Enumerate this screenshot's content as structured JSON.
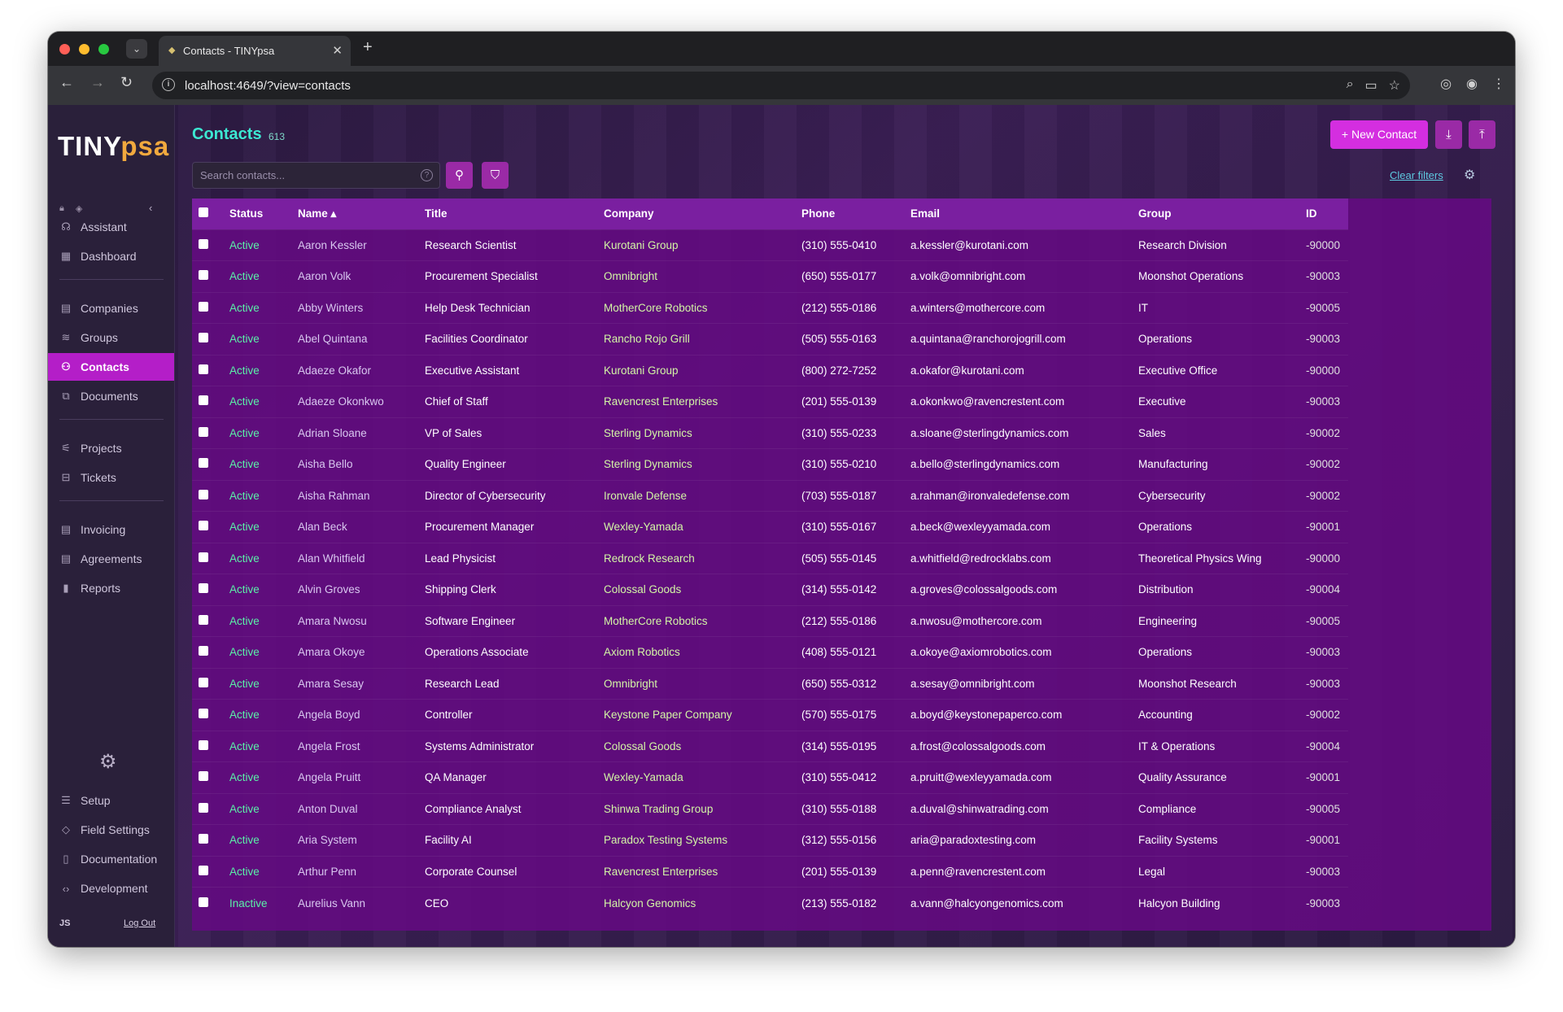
{
  "browser": {
    "tab_title": "Contacts - TINYpsa",
    "url": "localhost:4649/?view=contacts"
  },
  "app": {
    "logo_main": "TINY",
    "logo_accent": "psa",
    "sidebar": {
      "group1": [
        {
          "label": "Assistant",
          "icon": "headset-icon"
        },
        {
          "label": "Dashboard",
          "icon": "dashboard-icon"
        }
      ],
      "group2": [
        {
          "label": "Companies",
          "icon": "building-icon"
        },
        {
          "label": "Groups",
          "icon": "layers-icon"
        },
        {
          "label": "Contacts",
          "icon": "users-icon"
        },
        {
          "label": "Documents",
          "icon": "document-icon"
        }
      ],
      "group3": [
        {
          "label": "Projects",
          "icon": "projects-icon"
        },
        {
          "label": "Tickets",
          "icon": "ticket-icon"
        }
      ],
      "group4": [
        {
          "label": "Invoicing",
          "icon": "invoice-icon"
        },
        {
          "label": "Agreements",
          "icon": "agreement-icon"
        },
        {
          "label": "Reports",
          "icon": "chart-icon"
        }
      ],
      "bottom": [
        {
          "label": "Setup",
          "icon": "sliders-icon"
        },
        {
          "label": "Field Settings",
          "icon": "tag-icon"
        },
        {
          "label": "Documentation",
          "icon": "book-icon"
        },
        {
          "label": "Development",
          "icon": "code-icon"
        }
      ],
      "user_initials": "JS",
      "logout_label": "Log Out"
    },
    "page": {
      "title": "Contacts",
      "count": "613",
      "new_button": "+ New Contact",
      "search_placeholder": "Search contacts...",
      "clear_filters": "Clear filters"
    },
    "table": {
      "columns": [
        "Status",
        "Name ▴",
        "Title",
        "Company",
        "Phone",
        "Email",
        "Group",
        "ID"
      ],
      "rows": [
        [
          "Active",
          "Aaron Kessler",
          "Research Scientist",
          "Kurotani Group",
          "(310) 555-0410",
          "a.kessler@kurotani.com",
          "Research Division",
          "-90000"
        ],
        [
          "Active",
          "Aaron Volk",
          "Procurement Specialist",
          "Omnibright",
          "(650) 555-0177",
          "a.volk@omnibright.com",
          "Moonshot Operations",
          "-90003"
        ],
        [
          "Active",
          "Abby Winters",
          "Help Desk Technician",
          "MotherCore Robotics",
          "(212) 555-0186",
          "a.winters@mothercore.com",
          "IT",
          "-90005"
        ],
        [
          "Active",
          "Abel Quintana",
          "Facilities Coordinator",
          "Rancho Rojo Grill",
          "(505) 555-0163",
          "a.quintana@ranchorojogrill.com",
          "Operations",
          "-90003"
        ],
        [
          "Active",
          "Adaeze Okafor",
          "Executive Assistant",
          "Kurotani Group",
          "(800) 272-7252",
          "a.okafor@kurotani.com",
          "Executive Office",
          "-90000"
        ],
        [
          "Active",
          "Adaeze Okonkwo",
          "Chief of Staff",
          "Ravencrest Enterprises",
          "(201) 555-0139",
          "a.okonkwo@ravencrestent.com",
          "Executive",
          "-90003"
        ],
        [
          "Active",
          "Adrian Sloane",
          "VP of Sales",
          "Sterling Dynamics",
          "(310) 555-0233",
          "a.sloane@sterlingdynamics.com",
          "Sales",
          "-90002"
        ],
        [
          "Active",
          "Aisha Bello",
          "Quality Engineer",
          "Sterling Dynamics",
          "(310) 555-0210",
          "a.bello@sterlingdynamics.com",
          "Manufacturing",
          "-90002"
        ],
        [
          "Active",
          "Aisha Rahman",
          "Director of Cybersecurity",
          "Ironvale Defense",
          "(703) 555-0187",
          "a.rahman@ironvaledefense.com",
          "Cybersecurity",
          "-90002"
        ],
        [
          "Active",
          "Alan Beck",
          "Procurement Manager",
          "Wexley-Yamada",
          "(310) 555-0167",
          "a.beck@wexleyyamada.com",
          "Operations",
          "-90001"
        ],
        [
          "Active",
          "Alan Whitfield",
          "Lead Physicist",
          "Redrock Research",
          "(505) 555-0145",
          "a.whitfield@redrocklabs.com",
          "Theoretical Physics Wing",
          "-90000"
        ],
        [
          "Active",
          "Alvin Groves",
          "Shipping Clerk",
          "Colossal Goods",
          "(314) 555-0142",
          "a.groves@colossalgoods.com",
          "Distribution",
          "-90004"
        ],
        [
          "Active",
          "Amara Nwosu",
          "Software Engineer",
          "MotherCore Robotics",
          "(212) 555-0186",
          "a.nwosu@mothercore.com",
          "Engineering",
          "-90005"
        ],
        [
          "Active",
          "Amara Okoye",
          "Operations Associate",
          "Axiom Robotics",
          "(408) 555-0121",
          "a.okoye@axiomrobotics.com",
          "Operations",
          "-90003"
        ],
        [
          "Active",
          "Amara Sesay",
          "Research Lead",
          "Omnibright",
          "(650) 555-0312",
          "a.sesay@omnibright.com",
          "Moonshot Research",
          "-90003"
        ],
        [
          "Active",
          "Angela Boyd",
          "Controller",
          "Keystone Paper Company",
          "(570) 555-0175",
          "a.boyd@keystonepaperco.com",
          "Accounting",
          "-90002"
        ],
        [
          "Active",
          "Angela Frost",
          "Systems Administrator",
          "Colossal Goods",
          "(314) 555-0195",
          "a.frost@colossalgoods.com",
          "IT & Operations",
          "-90004"
        ],
        [
          "Active",
          "Angela Pruitt",
          "QA Manager",
          "Wexley-Yamada",
          "(310) 555-0412",
          "a.pruitt@wexleyyamada.com",
          "Quality Assurance",
          "-90001"
        ],
        [
          "Active",
          "Anton Duval",
          "Compliance Analyst",
          "Shinwa Trading Group",
          "(310) 555-0188",
          "a.duval@shinwatrading.com",
          "Compliance",
          "-90005"
        ],
        [
          "Active",
          "Aria System",
          "Facility AI",
          "Paradox Testing Systems",
          "(312) 555-0156",
          "aria@paradoxtesting.com",
          "Facility Systems",
          "-90001"
        ],
        [
          "Active",
          "Arthur Penn",
          "Corporate Counsel",
          "Ravencrest Enterprises",
          "(201) 555-0139",
          "a.penn@ravencrestent.com",
          "Legal",
          "-90003"
        ],
        [
          "Inactive",
          "Aurelius Vann",
          "CEO",
          "Halcyon Genomics",
          "(213) 555-0182",
          "a.vann@halcyongenomics.com",
          "Halcyon Building",
          "-90003"
        ]
      ]
    }
  }
}
